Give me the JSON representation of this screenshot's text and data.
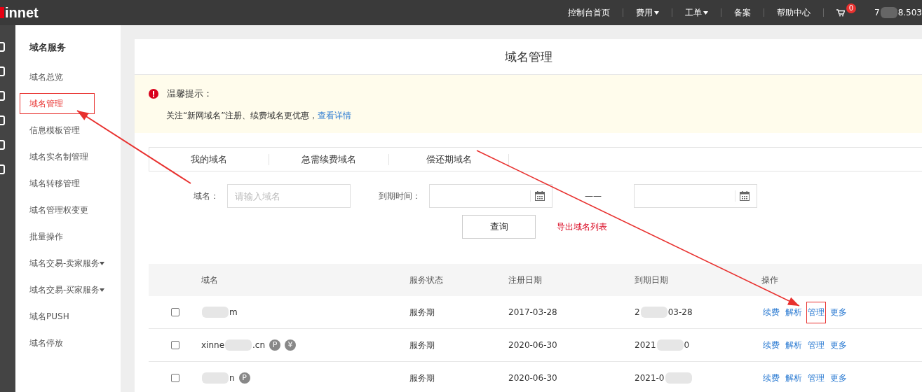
{
  "topbar": {
    "logo": "innet",
    "links": [
      {
        "label": "控制台首页",
        "dropdown": false
      },
      {
        "label": "费用",
        "dropdown": true
      },
      {
        "label": "工单",
        "dropdown": true
      },
      {
        "label": "备案",
        "dropdown": false
      },
      {
        "label": "帮助中心",
        "dropdown": false
      }
    ],
    "cart_count": "0",
    "account": [
      {
        "kind": "text",
        "text": "7"
      },
      {
        "kind": "blur"
      },
      {
        "kind": "text",
        "text": "8.503"
      }
    ]
  },
  "sidebar": {
    "title": "域名服务",
    "items": [
      {
        "label": "域名总览",
        "selected": false,
        "highlighted": false,
        "dropdown": false
      },
      {
        "label": "域名管理",
        "selected": true,
        "highlighted": true,
        "dropdown": false
      },
      {
        "label": "信息模板管理",
        "selected": false,
        "highlighted": false,
        "dropdown": false
      },
      {
        "label": "域名实名制管理",
        "selected": false,
        "highlighted": false,
        "dropdown": false
      },
      {
        "label": "域名转移管理",
        "selected": false,
        "highlighted": false,
        "dropdown": false
      },
      {
        "label": "域名管理权变更",
        "selected": false,
        "highlighted": false,
        "dropdown": false
      },
      {
        "label": "批量操作",
        "selected": false,
        "highlighted": false,
        "dropdown": false
      },
      {
        "label": "域名交易-卖家服务",
        "selected": false,
        "highlighted": false,
        "dropdown": true
      },
      {
        "label": "域名交易-买家服务",
        "selected": false,
        "highlighted": false,
        "dropdown": true
      },
      {
        "label": "域名PUSH",
        "selected": false,
        "highlighted": false,
        "dropdown": false
      },
      {
        "label": "域名停放",
        "selected": false,
        "highlighted": false,
        "dropdown": false
      }
    ]
  },
  "page_title": "域名管理",
  "notice": {
    "title": "温馨提示：",
    "text": "关注“新网域名”注册、续费域名更优惠，",
    "link": "查看详情"
  },
  "tabs": [
    {
      "label": "我的域名",
      "selected": false
    },
    {
      "label": "急需续费域名",
      "selected": false
    },
    {
      "label": "偿还期域名",
      "selected": false
    }
  ],
  "search": {
    "domain_label": "域名：",
    "domain_placeholder": "请输入域名",
    "date_label": "到期时间：",
    "range_separator": "——",
    "query_button": "查询",
    "export_link": "导出域名列表"
  },
  "table": {
    "columns": [
      "域名",
      "服务状态",
      "注册日期",
      "到期日期",
      "操作"
    ],
    "rows": [
      {
        "checked": false,
        "domain": [
          {
            "kind": "blur"
          },
          {
            "kind": "text",
            "text": "m"
          }
        ],
        "badges": [],
        "status": "服务期",
        "registered": "2017-03-28",
        "expires": [
          {
            "kind": "text",
            "text": "2"
          },
          {
            "kind": "blur"
          },
          {
            "kind": "text",
            "text": "03-28"
          }
        ],
        "actions": [
          {
            "label": "续费",
            "highlighted": false
          },
          {
            "label": "解析",
            "highlighted": false
          },
          {
            "label": "管理",
            "highlighted": true
          },
          {
            "label": "更多",
            "highlighted": false
          }
        ]
      },
      {
        "checked": false,
        "domain": [
          {
            "kind": "text",
            "text": "xinne"
          },
          {
            "kind": "blur"
          },
          {
            "kind": "text",
            "text": ".cn"
          }
        ],
        "badges": [
          "P",
          "¥"
        ],
        "status": "服务期",
        "registered": "2020-06-30",
        "expires": [
          {
            "kind": "text",
            "text": "2021"
          },
          {
            "kind": "blur"
          },
          {
            "kind": "text",
            "text": "0"
          }
        ],
        "actions": [
          {
            "label": "续费",
            "highlighted": false
          },
          {
            "label": "解析",
            "highlighted": false
          },
          {
            "label": "管理",
            "highlighted": false
          },
          {
            "label": "更多",
            "highlighted": false
          }
        ]
      },
      {
        "checked": false,
        "domain": [
          {
            "kind": "blur"
          },
          {
            "kind": "text",
            "text": "n"
          }
        ],
        "badges": [
          "P"
        ],
        "status": "服务期",
        "registered": "2020-06-30",
        "expires": [
          {
            "kind": "text",
            "text": "2021-0"
          },
          {
            "kind": "blur"
          }
        ],
        "actions": [
          {
            "label": "续费",
            "highlighted": false
          },
          {
            "label": "解析",
            "highlighted": false
          },
          {
            "label": "管理",
            "highlighted": false
          },
          {
            "label": "更多",
            "highlighted": false
          }
        ]
      }
    ]
  },
  "annotations": [
    {
      "kind": "arrow"
    },
    {
      "kind": "arrow"
    }
  ]
}
